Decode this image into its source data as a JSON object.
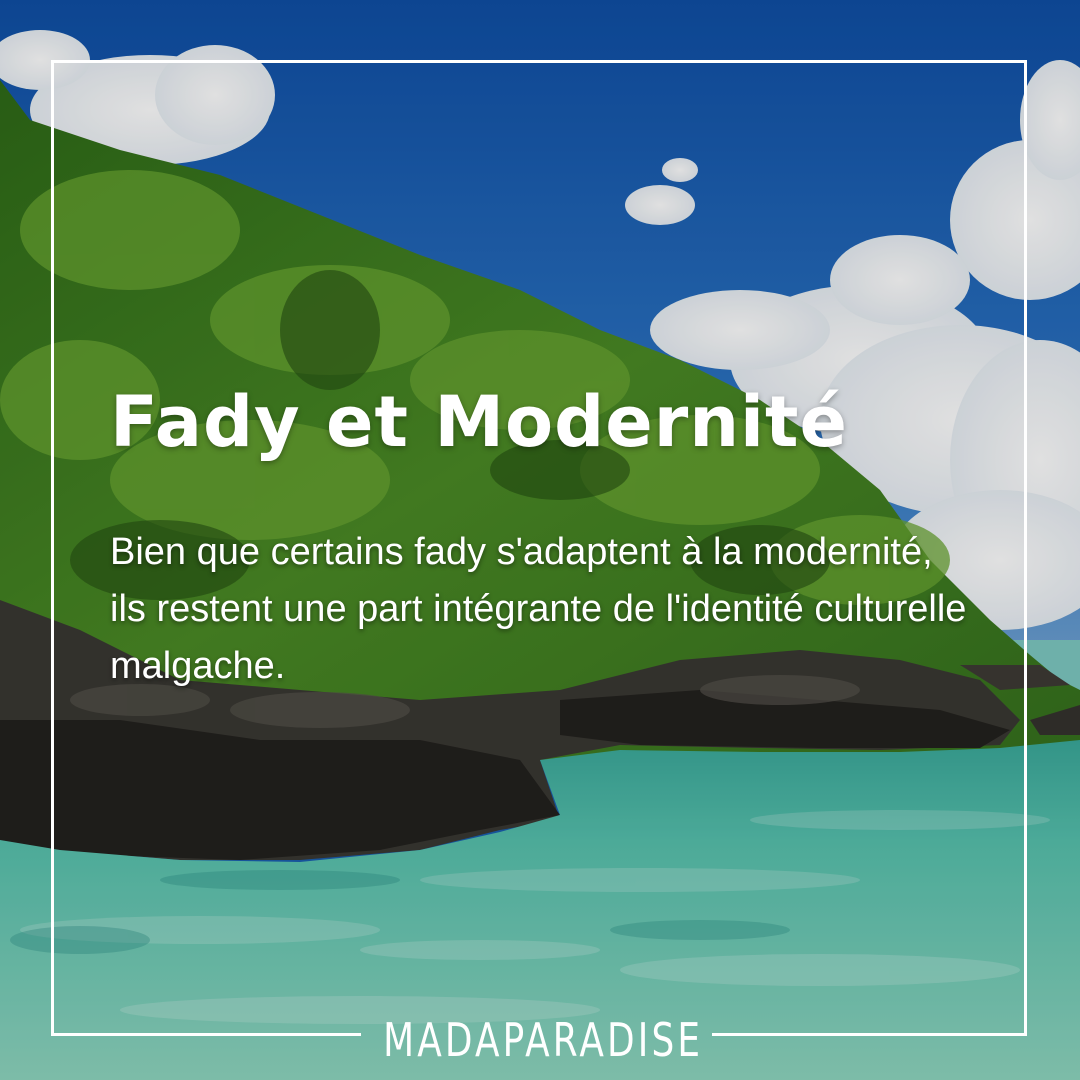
{
  "post": {
    "title": "Fady et Modernité",
    "body": "Bien que certains fady s'adaptent à la modernité, ils restent une part intégrante de l'identité culturelle malgache.",
    "brand": "MADAPARADISE"
  },
  "colors": {
    "sky": "#1a5fb0",
    "forest": "#3f7d1f",
    "rock": "#2e2c29",
    "water": "#5cc3b0",
    "text": "#ffffff"
  },
  "icons": {
    "brand_logo": "madagascar-island-letter-a-icon"
  }
}
